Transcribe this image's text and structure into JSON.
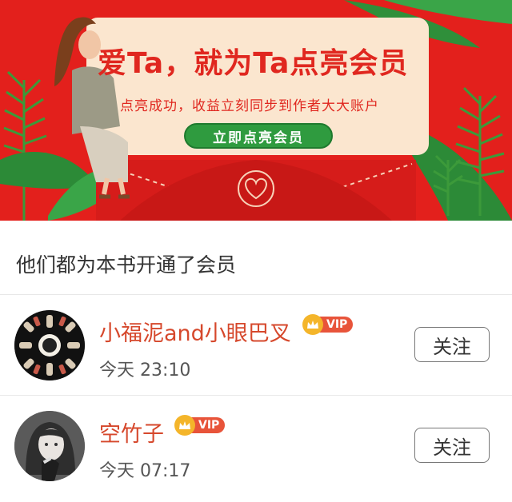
{
  "banner": {
    "headline": "爱Ta，就为Ta点亮会员",
    "subline": "点亮成功，收益立刻同步到作者大大账户",
    "cta_label": "立即点亮会员"
  },
  "section": {
    "title": "他们都为本书开通了会员"
  },
  "members": [
    {
      "name": "小福泥and小眼巴叉",
      "vip_label": "VIP",
      "time": "今天 23:10",
      "follow_label": "关注"
    },
    {
      "name": "空竹子",
      "vip_label": "VIP",
      "time": "今天 07:17",
      "follow_label": "关注"
    }
  ],
  "colors": {
    "banner_red": "#e3201c",
    "accent_green": "#2f9b3f",
    "name_orange": "#d6482c",
    "vip_red": "#e8543a",
    "crown_gold": "#f4b52a"
  }
}
